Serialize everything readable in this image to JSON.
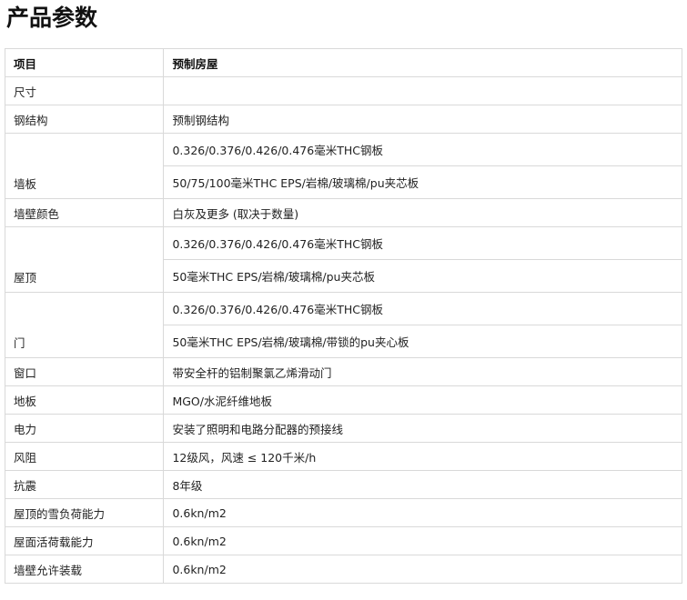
{
  "title": "产品参数",
  "table": {
    "header": {
      "item": "项目",
      "value": "预制房屋"
    },
    "rows": [
      {
        "label": "尺寸",
        "values": [
          ""
        ]
      },
      {
        "label": "钢结构",
        "values": [
          "预制钢结构"
        ]
      },
      {
        "label": "墙板",
        "values": [
          "0.326/0.376/0.426/0.476毫米THC钢板",
          "50/75/100毫米THC EPS/岩棉/玻璃棉/pu夹芯板"
        ]
      },
      {
        "label": "墙壁颜色",
        "values": [
          "白灰及更多 (取决于数量)"
        ]
      },
      {
        "label": "屋顶",
        "values": [
          "0.326/0.376/0.426/0.476毫米THC钢板",
          "50毫米THC EPS/岩棉/玻璃棉/pu夹芯板"
        ]
      },
      {
        "label": "门",
        "values": [
          "0.326/0.376/0.426/0.476毫米THC钢板",
          "50毫米THC EPS/岩棉/玻璃棉/带锁的pu夹心板"
        ]
      },
      {
        "label": "窗口",
        "values": [
          "带安全杆的铝制聚氯乙烯滑动门"
        ]
      },
      {
        "label": "地板",
        "values": [
          "MGO/水泥纤维地板"
        ]
      },
      {
        "label": "电力",
        "values": [
          "安装了照明和电路分配器的预接线"
        ]
      },
      {
        "label": "风阻",
        "values": [
          "12级风，风速 ≤ 120千米/h"
        ]
      },
      {
        "label": "抗震",
        "values": [
          "8年级"
        ]
      },
      {
        "label": "屋顶的雪负荷能力",
        "values": [
          "0.6kn/m2"
        ]
      },
      {
        "label": "屋面活荷载能力",
        "values": [
          "0.6kn/m2"
        ]
      },
      {
        "label": "墙壁允许装载",
        "values": [
          "0.6kn/m2"
        ]
      }
    ]
  }
}
